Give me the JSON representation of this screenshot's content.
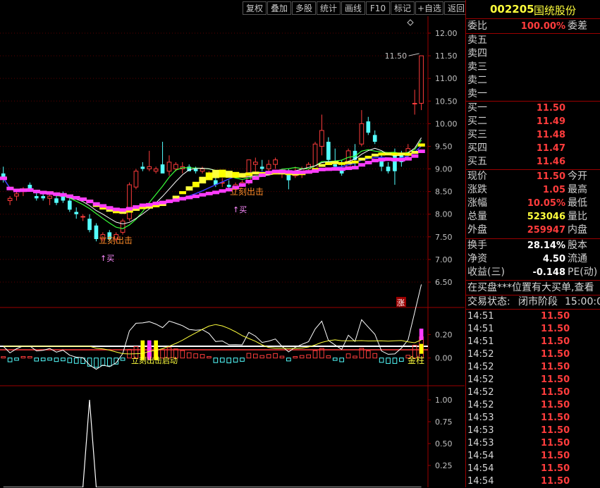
{
  "toolbar": {
    "buttons": [
      "复权",
      "叠加",
      "多股",
      "统计",
      "画线",
      "F10",
      "标记",
      "+自选",
      "返回"
    ]
  },
  "stock": {
    "code": "002205",
    "name": "国统股份"
  },
  "order_book": {
    "ratio_label": "委比",
    "ratio_value": "100.00%",
    "diff_label": "委差",
    "sell": [
      {
        "label": "卖五",
        "price": "",
        "vol": ""
      },
      {
        "label": "卖四",
        "price": "",
        "vol": ""
      },
      {
        "label": "卖三",
        "price": "",
        "vol": ""
      },
      {
        "label": "卖二",
        "price": "",
        "vol": ""
      },
      {
        "label": "卖一",
        "price": "",
        "vol": ""
      }
    ],
    "buy": [
      {
        "label": "买一",
        "price": "11.50"
      },
      {
        "label": "买二",
        "price": "11.49"
      },
      {
        "label": "买三",
        "price": "11.48"
      },
      {
        "label": "买四",
        "price": "11.47"
      },
      {
        "label": "买五",
        "price": "11.46"
      }
    ]
  },
  "quote": {
    "rows": [
      {
        "label": "现价",
        "value": "11.50",
        "color": "#ff3c3c",
        "label2": "今开"
      },
      {
        "label": "涨跌",
        "value": "1.05",
        "color": "#ff3c3c",
        "label2": "最高"
      },
      {
        "label": "涨幅",
        "value": "10.05%",
        "color": "#ff3c3c",
        "label2": "最低"
      },
      {
        "label": "总量",
        "value": "523046",
        "color": "#ffff3c",
        "label2": "量比"
      },
      {
        "label": "外盘",
        "value": "259947",
        "color": "#ff3c3c",
        "label2": "内盘"
      }
    ],
    "rows2": [
      {
        "label": "换手",
        "value": "28.14%",
        "color": "#ffffff",
        "label2": "股本"
      },
      {
        "label": "净资",
        "value": "4.50",
        "color": "#ffffff",
        "label2": "流通"
      },
      {
        "label": "收益(三)",
        "value": "-0.148",
        "color": "#ffffff",
        "label2": "PE(动)"
      }
    ],
    "notice": "在买盘***位置有大买单,查看",
    "status_label": "交易状态:",
    "status_value": "闭市阶段",
    "status_time": "15:00:00"
  },
  "ticks": [
    {
      "time": "14:51",
      "price": "11.50"
    },
    {
      "time": "14:51",
      "price": "11.50"
    },
    {
      "time": "14:51",
      "price": "11.50"
    },
    {
      "time": "14:52",
      "price": "11.50"
    },
    {
      "time": "14:52",
      "price": "11.50"
    },
    {
      "time": "14:52",
      "price": "11.50"
    },
    {
      "time": "14:52",
      "price": "11.50"
    },
    {
      "time": "14:52",
      "price": "11.50"
    },
    {
      "time": "14:53",
      "price": "11.50"
    },
    {
      "time": "14:53",
      "price": "11.50"
    },
    {
      "time": "14:53",
      "price": "11.50"
    },
    {
      "time": "14:54",
      "price": "11.50"
    },
    {
      "time": "14:54",
      "price": "11.50"
    },
    {
      "time": "14:54",
      "price": "11.50"
    }
  ],
  "main_chart": {
    "y_ticks": [
      "12.00",
      "11.50",
      "11.00",
      "10.50",
      "10.00",
      "9.50",
      "9.00",
      "8.50",
      "8.00",
      "7.50",
      "7.00",
      "6.50"
    ],
    "high_label": "11.50",
    "limit_badge": "涨",
    "signals": [
      {
        "text": "立刻出击",
        "color": "#ff8c28"
      },
      {
        "text": "立刻出击",
        "color": "#ff8c28"
      },
      {
        "text": "↑买",
        "color": "#ff8cff"
      },
      {
        "text": "↑买",
        "color": "#ff8cff"
      }
    ]
  },
  "sub_chart": {
    "y_ticks": [
      "0.20",
      "0.00"
    ],
    "labels": [
      {
        "text": "金柱",
        "color": "#ffff3c"
      },
      {
        "text": "立刻出击启动",
        "color": "#ffff3c"
      }
    ]
  },
  "bottom_chart": {
    "y_ticks": [
      "1.00",
      "0.75",
      "0.50",
      "0.25"
    ]
  },
  "chart_data": {
    "type": "candlestick",
    "candles": [
      {
        "o": 8.9,
        "h": 9.05,
        "l": 8.7,
        "c": 8.8
      },
      {
        "o": 8.3,
        "h": 8.4,
        "l": 8.2,
        "c": 8.35
      },
      {
        "o": 8.4,
        "h": 8.5,
        "l": 8.3,
        "c": 8.45
      },
      {
        "o": 8.5,
        "h": 8.6,
        "l": 8.4,
        "c": 8.55
      },
      {
        "o": 8.65,
        "h": 8.7,
        "l": 8.5,
        "c": 8.55
      },
      {
        "o": 8.4,
        "h": 8.5,
        "l": 8.3,
        "c": 8.35
      },
      {
        "o": 8.4,
        "h": 8.45,
        "l": 8.3,
        "c": 8.35
      },
      {
        "o": 8.35,
        "h": 8.45,
        "l": 8.2,
        "c": 8.4
      },
      {
        "o": 8.35,
        "h": 8.45,
        "l": 8.2,
        "c": 8.25
      },
      {
        "o": 8.4,
        "h": 8.5,
        "l": 8.25,
        "c": 8.3
      },
      {
        "o": 8.3,
        "h": 8.35,
        "l": 8.05,
        "c": 8.1
      },
      {
        "o": 8.05,
        "h": 8.15,
        "l": 7.9,
        "c": 8.0
      },
      {
        "o": 7.95,
        "h": 8.0,
        "l": 7.85,
        "c": 7.95
      },
      {
        "o": 7.9,
        "h": 8.0,
        "l": 7.6,
        "c": 7.65
      },
      {
        "o": 7.75,
        "h": 7.8,
        "l": 7.4,
        "c": 7.45
      },
      {
        "o": 7.45,
        "h": 7.6,
        "l": 7.4,
        "c": 7.55
      },
      {
        "o": 7.6,
        "h": 7.65,
        "l": 7.4,
        "c": 7.45
      },
      {
        "o": 7.45,
        "h": 7.6,
        "l": 7.4,
        "c": 7.55
      },
      {
        "o": 7.6,
        "h": 7.9,
        "l": 7.55,
        "c": 7.85
      },
      {
        "o": 7.9,
        "h": 8.7,
        "l": 7.85,
        "c": 8.65
      },
      {
        "o": 8.6,
        "h": 9.0,
        "l": 8.55,
        "c": 8.95
      },
      {
        "o": 9.05,
        "h": 9.15,
        "l": 8.95,
        "c": 9.0
      },
      {
        "o": 9.0,
        "h": 9.4,
        "l": 8.95,
        "c": 9.05
      },
      {
        "o": 8.95,
        "h": 9.05,
        "l": 8.9,
        "c": 9.0
      },
      {
        "o": 9.1,
        "h": 9.6,
        "l": 8.95,
        "c": 8.9
      },
      {
        "o": 8.95,
        "h": 9.3,
        "l": 8.85,
        "c": 9.15
      },
      {
        "o": 9.0,
        "h": 9.15,
        "l": 8.95,
        "c": 9.1
      },
      {
        "o": 9.0,
        "h": 9.15,
        "l": 8.9,
        "c": 9.05
      },
      {
        "o": 9.05,
        "h": 9.1,
        "l": 8.95,
        "c": 8.95
      },
      {
        "o": 9.0,
        "h": 9.05,
        "l": 8.9,
        "c": 8.95
      },
      {
        "o": 8.95,
        "h": 9.05,
        "l": 8.9,
        "c": 9.0
      },
      {
        "o": 8.85,
        "h": 8.95,
        "l": 8.8,
        "c": 8.9
      },
      {
        "o": 8.75,
        "h": 8.9,
        "l": 8.6,
        "c": 8.65
      },
      {
        "o": 8.7,
        "h": 8.8,
        "l": 8.6,
        "c": 8.7
      },
      {
        "o": 8.65,
        "h": 8.75,
        "l": 8.55,
        "c": 8.6
      },
      {
        "o": 8.6,
        "h": 8.7,
        "l": 8.5,
        "c": 8.65
      },
      {
        "o": 8.65,
        "h": 8.75,
        "l": 8.6,
        "c": 8.7
      },
      {
        "o": 8.7,
        "h": 9.1,
        "l": 8.65,
        "c": 9.2
      },
      {
        "o": 9.1,
        "h": 9.25,
        "l": 8.9,
        "c": 9.15
      },
      {
        "o": 9.05,
        "h": 9.2,
        "l": 8.95,
        "c": 9.0
      },
      {
        "o": 9.0,
        "h": 9.2,
        "l": 8.9,
        "c": 9.1
      },
      {
        "o": 9.1,
        "h": 9.25,
        "l": 9.0,
        "c": 9.2
      },
      {
        "o": 8.95,
        "h": 9.0,
        "l": 8.8,
        "c": 8.95
      },
      {
        "o": 8.9,
        "h": 9.0,
        "l": 8.55,
        "c": 8.75
      },
      {
        "o": 8.85,
        "h": 9.05,
        "l": 8.8,
        "c": 8.9
      },
      {
        "o": 8.9,
        "h": 9.05,
        "l": 8.8,
        "c": 9.0
      },
      {
        "o": 9.0,
        "h": 9.15,
        "l": 8.95,
        "c": 9.1
      },
      {
        "o": 9.0,
        "h": 9.6,
        "l": 8.95,
        "c": 9.55
      },
      {
        "o": 9.5,
        "h": 10.2,
        "l": 9.3,
        "c": 9.85
      },
      {
        "o": 9.6,
        "h": 9.7,
        "l": 9.15,
        "c": 9.2
      },
      {
        "o": 9.1,
        "h": 9.45,
        "l": 9.0,
        "c": 9.05
      },
      {
        "o": 9.0,
        "h": 9.2,
        "l": 8.85,
        "c": 8.9
      },
      {
        "o": 9.05,
        "h": 9.45,
        "l": 9.0,
        "c": 9.4
      },
      {
        "o": 9.4,
        "h": 9.55,
        "l": 9.0,
        "c": 9.2
      },
      {
        "o": 9.55,
        "h": 10.3,
        "l": 9.5,
        "c": 10.0
      },
      {
        "o": 10.05,
        "h": 10.15,
        "l": 9.75,
        "c": 9.8
      },
      {
        "o": 9.75,
        "h": 9.85,
        "l": 9.55,
        "c": 9.6
      },
      {
        "o": 9.2,
        "h": 9.3,
        "l": 8.95,
        "c": 9.05
      },
      {
        "o": 9.05,
        "h": 9.15,
        "l": 8.9,
        "c": 8.95
      },
      {
        "o": 9.3,
        "h": 9.45,
        "l": 8.65,
        "c": 8.95
      },
      {
        "o": 9.3,
        "h": 9.4,
        "l": 9.05,
        "c": 9.15
      },
      {
        "o": 9.35,
        "h": 9.55,
        "l": 9.2,
        "c": 9.45
      },
      {
        "o": 10.45,
        "h": 10.75,
        "l": 10.2,
        "c": 10.45
      },
      {
        "o": 10.45,
        "h": 11.5,
        "l": 10.3,
        "c": 11.5
      }
    ]
  }
}
